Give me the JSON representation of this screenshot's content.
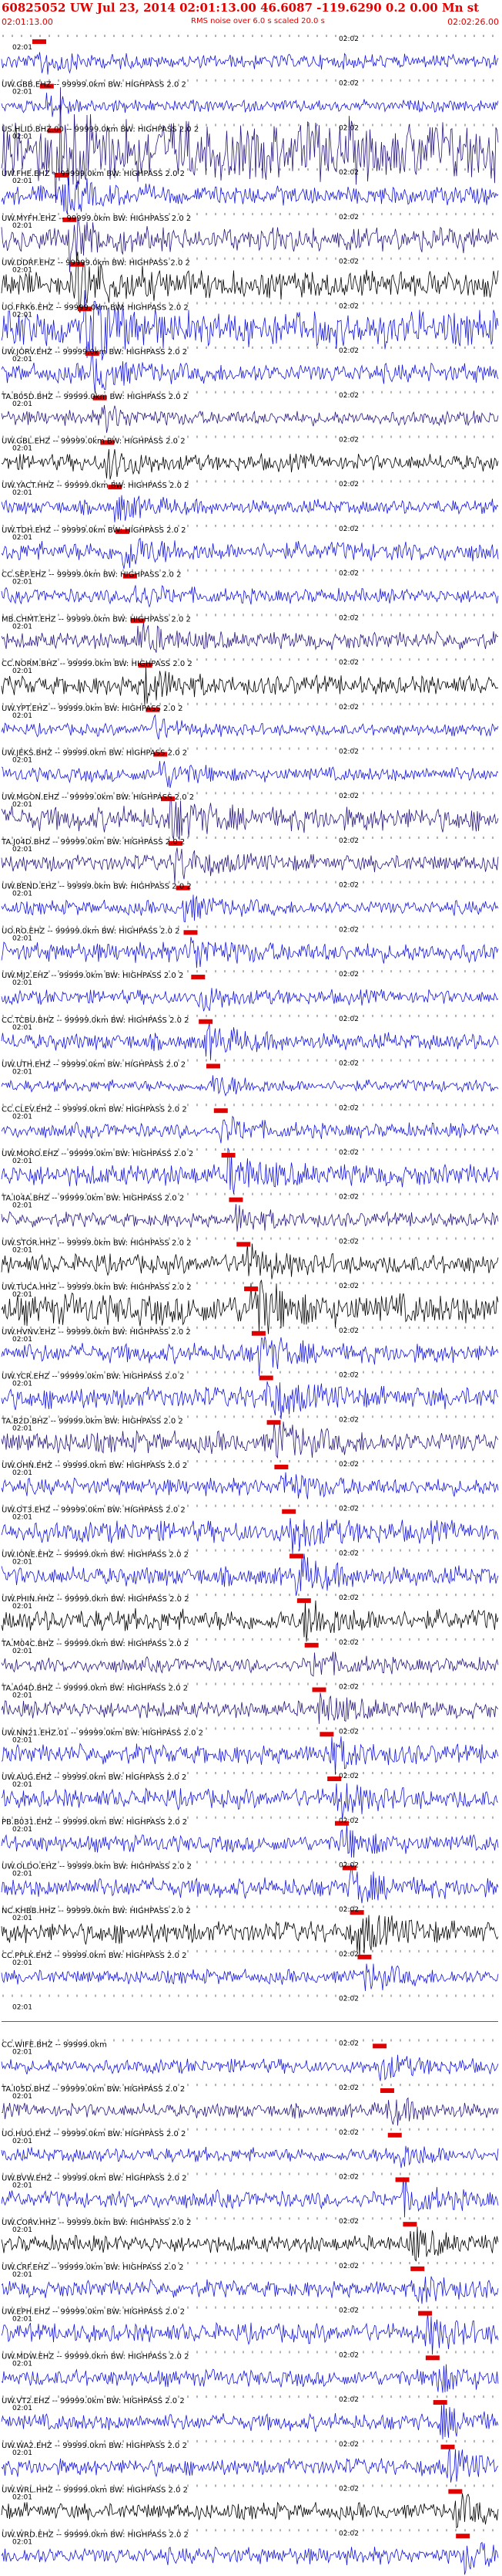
{
  "header": {
    "title": "60825052 UW Jul 23, 2014 02:01:13.00   46.6087 -119.6290  0.2 0.00 Mn st",
    "start_time": "02:01:13.00",
    "rms_note": "RMS noise over 6.0 s scaled 20.0 s",
    "end_time": "02:02:26.00"
  },
  "chart_data": {
    "type": "seismogram",
    "x_tick_labels": [
      "02:01",
      "02:02"
    ],
    "pick_color": "#e00000",
    "trace_colors": {
      "blue": "#1515e0",
      "purple": "#2a1680",
      "black": "#000000"
    },
    "traces": [
      {
        "label": "",
        "color": "blue",
        "amp": 0.6
      },
      {
        "label": "UW.GBB.EHZ -- 99999.0km BW: HIGHPASS 2.0 2",
        "color": "blue",
        "amp": 0.5
      },
      {
        "label": "US.HLID.BHZ.00 -- 99999.0km BW: HIGHPASS 2.0 2",
        "color": "purple",
        "amp": 2.5
      },
      {
        "label": "UW.FHE.EHZ -- 99999.0km BW: HIGHPASS 2.0 2",
        "color": "blue",
        "amp": 0.8
      },
      {
        "label": "UW.MYFH.EHZ -- 99999.0km BW: HIGHPASS 2.0 2",
        "color": "purple",
        "amp": 1.0
      },
      {
        "label": "UW.DDRF.EHZ -- 99999.0km BW: HIGHPASS 2.0 2",
        "color": "black",
        "amp": 1.2
      },
      {
        "label": "UO.FRK6.EHZ -- 99999.0km BW: HIGHPASS 2.0 2",
        "color": "blue",
        "amp": 1.5
      },
      {
        "label": "UW.JORV.EHZ -- 99999.0km BW: HIGHPASS 2.0 2",
        "color": "blue",
        "amp": 0.8
      },
      {
        "label": "TA.B05D.BHZ -- 99999.0km BW: HIGHPASS 2.0 2",
        "color": "purple",
        "amp": 0.6
      },
      {
        "label": "UW.GBL.EHZ -- 99999.0km BW: HIGHPASS 2.0 2",
        "color": "black",
        "amp": 0.7
      },
      {
        "label": "UW.YACT.HHZ -- 99999.0km BW: HIGHPASS 2.0 2",
        "color": "blue",
        "amp": 0.6
      },
      {
        "label": "UW.TDH.EHZ -- 99999.0km BW: HIGHPASS 2.0 2",
        "color": "blue",
        "amp": 0.8
      },
      {
        "label": "CC.SEP.EHZ -- 99999.0km BW: HIGHPASS 2.0 2",
        "color": "blue",
        "amp": 0.6
      },
      {
        "label": "MB.CHMT.EHZ -- 99999.0km BW: HIGHPASS 2.0 2",
        "color": "purple",
        "amp": 0.7
      },
      {
        "label": "CC.NORM.BHZ -- 99999.0km BW: HIGHPASS 2.0 2",
        "color": "black",
        "amp": 0.8
      },
      {
        "label": "UW.YPT.EHZ -- 99999.0km BW: HIGHPASS 2.0 2",
        "color": "blue",
        "amp": 0.5
      },
      {
        "label": "UW.JEKS.BHZ -- 99999.0km BW: HIGHPASS 2.0 2",
        "color": "blue",
        "amp": 0.6
      },
      {
        "label": "UW.MGON.EHZ -- 99999.0km BW: HIGHPASS 2.0 2",
        "color": "purple",
        "amp": 1.0
      },
      {
        "label": "TA.J04D.BHZ -- 99999.0km BW: HIGHPASS 2.0 2",
        "color": "purple",
        "amp": 0.7
      },
      {
        "label": "UW.BEND.EHZ -- 99999.0km BW: HIGHPASS 2.0 2",
        "color": "blue",
        "amp": 0.6
      },
      {
        "label": "UO.RO.EHZ -- 99999.0km BW: HIGHPASS 2.0 2",
        "color": "blue",
        "amp": 0.8
      },
      {
        "label": "UW.MJ2.EHZ -- 99999.0km BW: HIGHPASS 2.0 2",
        "color": "blue",
        "amp": 0.6
      },
      {
        "label": "CC.TCBU.BHZ -- 99999.0km BW: HIGHPASS 2.0 2",
        "color": "blue",
        "amp": 0.7
      },
      {
        "label": "UW.UTH.EHZ -- 99999.0km BW: HIGHPASS 2.0 2",
        "color": "blue",
        "amp": 0.5
      },
      {
        "label": "CC.CLEV.EHZ -- 99999.0km BW: HIGHPASS 2.0 2",
        "color": "blue",
        "amp": 0.6
      },
      {
        "label": "UW.MORO.EHZ -- 99999.0km BW: HIGHPASS 2.0 2",
        "color": "blue",
        "amp": 0.9
      },
      {
        "label": "TA.I04A.BHZ -- 99999.0km BW: HIGHPASS 2.0 2",
        "color": "purple",
        "amp": 0.6
      },
      {
        "label": "UW.STOR.HHZ -- 99999.0km BW: HIGHPASS 2.0 2",
        "color": "black",
        "amp": 0.8
      },
      {
        "label": "UW.TUCA.HHZ -- 99999.0km BW: HIGHPASS 2.0 2",
        "color": "black",
        "amp": 1.3
      },
      {
        "label": "UW.HVNV.EHZ -- 99999.0km BW: HIGHPASS 2.0 2",
        "color": "blue",
        "amp": 0.8
      },
      {
        "label": "UW.YCR.EHZ -- 99999.0km BW: HIGHPASS 2.0 2",
        "color": "blue",
        "amp": 0.9
      },
      {
        "label": "TA.B2D.BHZ -- 99999.0km BW: HIGHPASS 2.0 2",
        "color": "purple",
        "amp": 0.9
      },
      {
        "label": "UW.OHN.EHZ -- 99999.0km BW: HIGHPASS 2.0 2",
        "color": "blue",
        "amp": 0.7
      },
      {
        "label": "UW.OT3.EHZ -- 99999.0km BW: HIGHPASS 2.0 2",
        "color": "blue",
        "amp": 0.9
      },
      {
        "label": "UW.IONE.EHZ -- 99999.0km BW: HIGHPASS 2.0 2",
        "color": "blue",
        "amp": 0.8
      },
      {
        "label": "UW.PHIN.HHZ -- 99999.0km BW: HIGHPASS 2.0 2",
        "color": "black",
        "amp": 0.9
      },
      {
        "label": "TA.M04C.BHZ -- 99999.0km BW: HIGHPASS 2.0 2",
        "color": "purple",
        "amp": 0.6
      },
      {
        "label": "TA.A04D.BHZ -- 99999.0km BW: HIGHPASS 2.0 2",
        "color": "purple",
        "amp": 0.7
      },
      {
        "label": "UW.NN21.EHZ.01 -- 99999.0km BW: HIGHPASS 2.0 2",
        "color": "blue",
        "amp": 0.8
      },
      {
        "label": "UW.AUG.EHZ -- 99999.0km BW: HIGHPASS 2.0 2",
        "color": "blue",
        "amp": 0.8
      },
      {
        "label": "PB.B031.EHZ -- 99999.0km BW: HIGHPASS 2.0 2",
        "color": "blue",
        "amp": 0.7
      },
      {
        "label": "UW.OLDO.EHZ -- 99999.0km BW: HIGHPASS 2.0 2",
        "color": "blue",
        "amp": 0.8
      },
      {
        "label": "NC.KHBB.HHZ -- 99999.0km BW: HIGHPASS 2.0 2",
        "color": "black",
        "amp": 0.9
      },
      {
        "label": "CC.PPLK.EHZ -- 99999.0km BW: HIGHPASS 2.0 2",
        "color": "blue",
        "amp": 0.6
      },
      {
        "label": "",
        "color": "blue",
        "amp": 0.0
      },
      {
        "label": "CC.WIFE.BHZ -- 99999.0km",
        "color": "blue",
        "amp": 0.6
      },
      {
        "label": "TA.I05D.BHZ -- 99999.0km BW: HIGHPASS 2.0 2",
        "color": "purple",
        "amp": 0.6
      },
      {
        "label": "UO.HUO.EHZ -- 99999.0km BW: HIGHPASS 2.0 2",
        "color": "blue",
        "amp": 0.6
      },
      {
        "label": "UW.BVW.EHZ -- 99999.0km BW: HIGHPASS 2.0 2",
        "color": "blue",
        "amp": 0.7
      },
      {
        "label": "UW.CORV.HHZ -- 99999.0km BW: HIGHPASS 2.0 2",
        "color": "black",
        "amp": 0.7
      },
      {
        "label": "UW.CRF.EHZ -- 99999.0km BW: HIGHPASS 2.0 2",
        "color": "blue",
        "amp": 0.7
      },
      {
        "label": "UW.EPH.EHZ -- 99999.0km BW: HIGHPASS 2.0 2",
        "color": "blue",
        "amp": 0.8
      },
      {
        "label": "UW.MDW.EHZ -- 99999.0km BW: HIGHPASS 2.0 2",
        "color": "blue",
        "amp": 0.7
      },
      {
        "label": "UW.VT2.EHZ -- 99999.0km BW: HIGHPASS 2.0 2",
        "color": "blue",
        "amp": 0.7
      },
      {
        "label": "UW.WA2.EHZ -- 99999.0km BW: HIGHPASS 2.0 2",
        "color": "blue",
        "amp": 0.7
      },
      {
        "label": "UW.WRL.HHZ -- 99999.0km BW: HIGHPASS 2.0 2",
        "color": "black",
        "amp": 0.7
      },
      {
        "label": "UW.WRD.EHZ -- 99999.0km BW: HIGHPASS 2.0 2",
        "color": "blue",
        "amp": 0.7
      }
    ]
  }
}
